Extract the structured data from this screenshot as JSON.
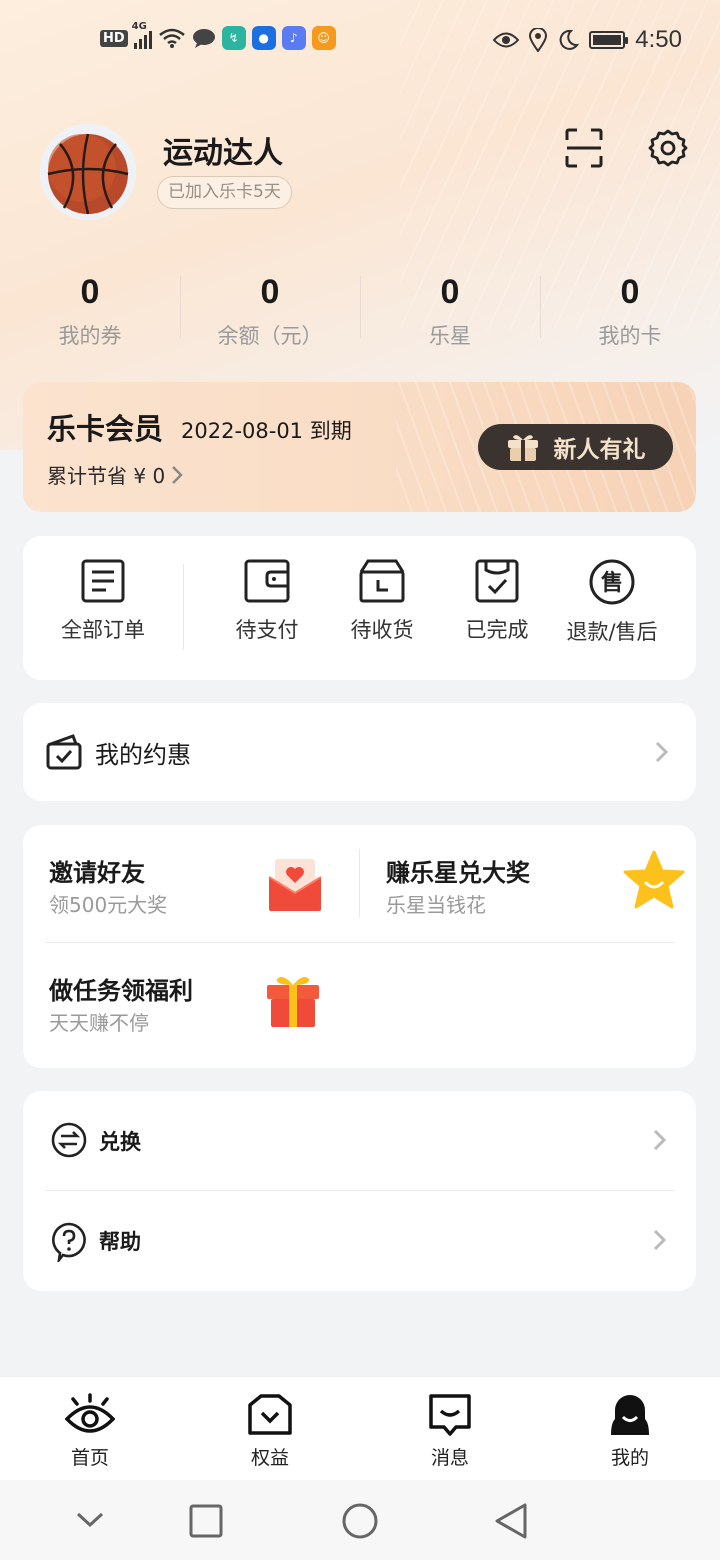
{
  "status_bar": {
    "hd": "HD",
    "signal": "4G",
    "time": "4:50"
  },
  "profile": {
    "username": "运动达人",
    "join_badge": "已加入乐卡5天"
  },
  "stats": [
    {
      "value": "0",
      "label": "我的券"
    },
    {
      "value": "0",
      "label": "余额（元）"
    },
    {
      "value": "0",
      "label": "乐星"
    },
    {
      "value": "0",
      "label": "我的卡"
    }
  ],
  "member": {
    "title": "乐卡会员",
    "expire": "2022-08-01 到期",
    "saved": "累计节省 ¥ 0",
    "gift_button": "新人有礼"
  },
  "orders": [
    {
      "label": "全部订单",
      "icon": "all-orders-icon"
    },
    {
      "label": "待支付",
      "icon": "wallet-icon"
    },
    {
      "label": "待收货",
      "icon": "delivery-box-icon"
    },
    {
      "label": "已完成",
      "icon": "completed-icon"
    },
    {
      "label": "退款/售后",
      "icon": "after-sale-icon"
    }
  ],
  "coupon_row": {
    "label": "我的约惠"
  },
  "promos": {
    "invite": {
      "title": "邀请好友",
      "sub": "领500元大奖"
    },
    "stars": {
      "title": "赚乐星兑大奖",
      "sub": "乐星当钱花"
    },
    "tasks": {
      "title": "做任务领福利",
      "sub": "天天赚不停"
    }
  },
  "misc": {
    "exchange": "兑换",
    "help": "帮助"
  },
  "bottom_nav": [
    {
      "label": "首页",
      "icon": "eye-home-icon"
    },
    {
      "label": "权益",
      "icon": "benefits-icon"
    },
    {
      "label": "消息",
      "icon": "message-icon"
    },
    {
      "label": "我的",
      "icon": "profile-icon"
    }
  ],
  "colors": {
    "accent_dark": "#3a3330",
    "gift_text": "#f3e1c9",
    "promo_red": "#f04a3a",
    "star_yellow": "#fcc21b"
  }
}
